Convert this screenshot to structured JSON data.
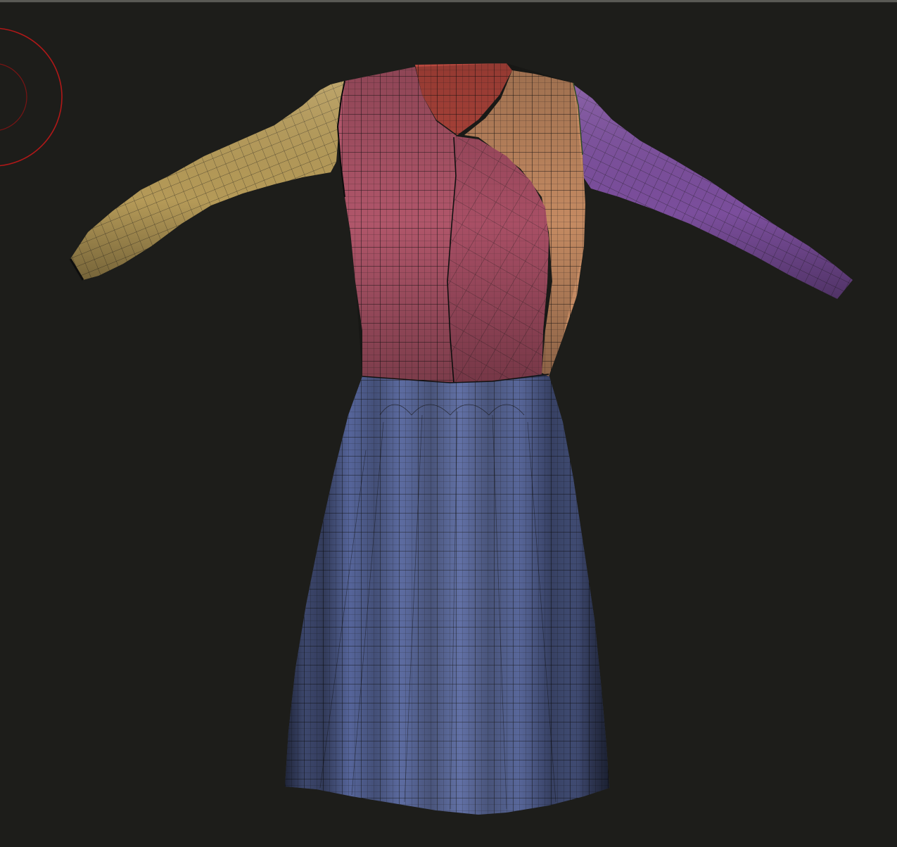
{
  "viewport": {
    "background": "#1d1d1a"
  },
  "brush_cursor": {
    "icon": "brush-cursor-icon",
    "color": "#b01818"
  },
  "model": {
    "panels": [
      {
        "name": "left-sleeve",
        "color": "#b59a58"
      },
      {
        "name": "bodice-front-left",
        "color": "#b0566a"
      },
      {
        "name": "bodice-neck-inner",
        "color": "#b8483e"
      },
      {
        "name": "bodice-front-right",
        "color": "#c48a62"
      },
      {
        "name": "right-sleeve",
        "color": "#7b4e9c"
      },
      {
        "name": "skirt",
        "color": "#5a6aa2"
      }
    ],
    "wireframe_color": "#141414"
  }
}
